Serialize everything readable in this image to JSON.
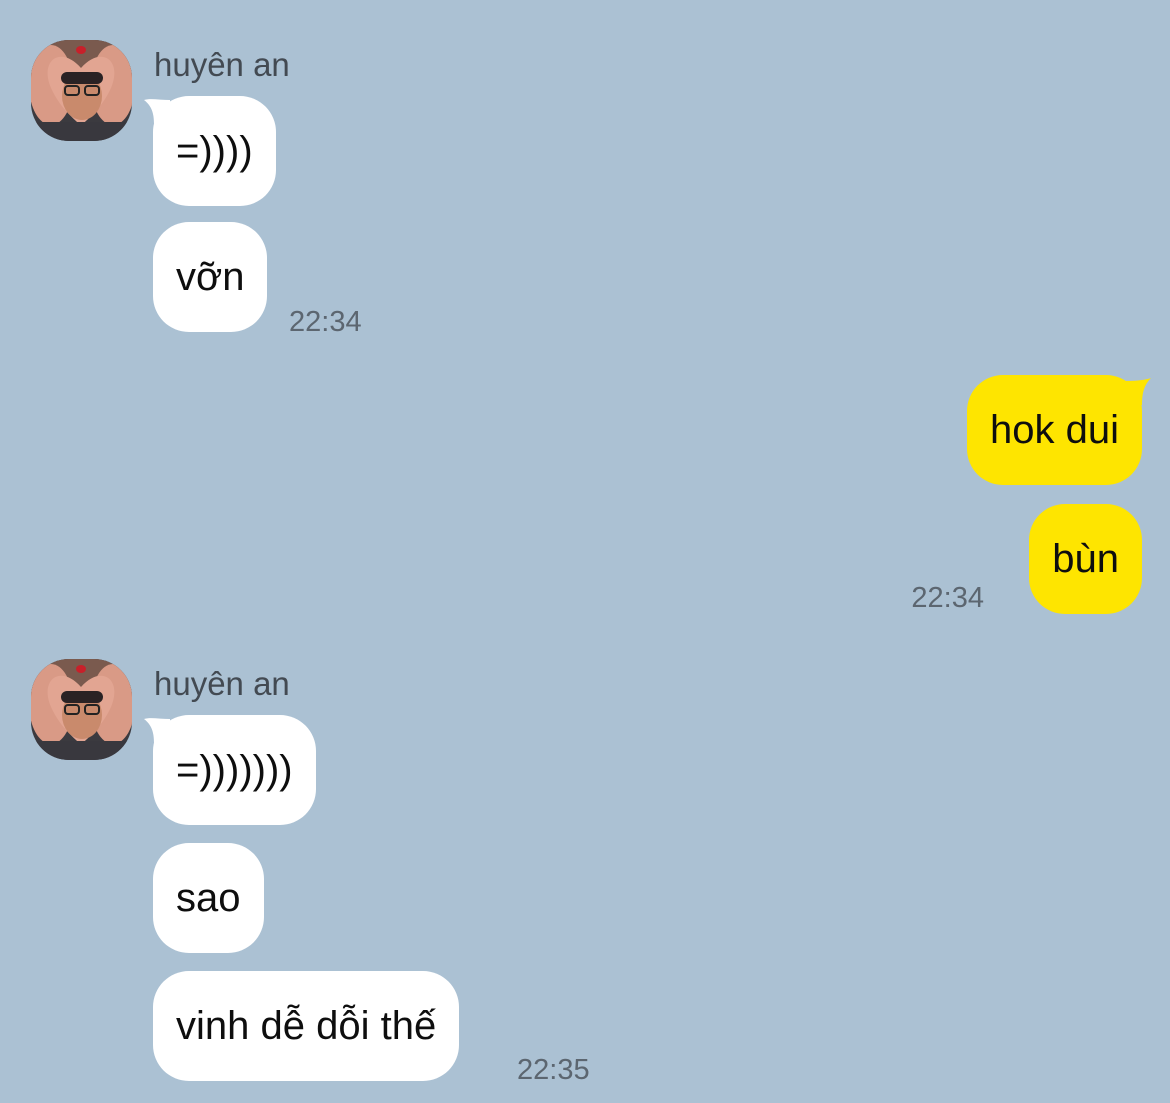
{
  "colors": {
    "background": "#abc1d3",
    "incoming_bubble": "#ffffff",
    "outgoing_bubble": "#fee500",
    "timestamp": "#5c6670",
    "sender_name": "#434a52"
  },
  "groups": [
    {
      "direction": "incoming",
      "sender": "huyên an",
      "avatar_icon": "profile-photo-heart-hands",
      "messages": [
        "=))))",
        "vỡn"
      ],
      "time": "22:34"
    },
    {
      "direction": "outgoing",
      "messages": [
        "hok dui",
        "bùn"
      ],
      "time": "22:34"
    },
    {
      "direction": "incoming",
      "sender": "huyên an",
      "avatar_icon": "profile-photo-heart-hands",
      "messages": [
        "=)))))))",
        "sao",
        "vinh dễ dỗi thế"
      ],
      "time": "22:35"
    }
  ]
}
